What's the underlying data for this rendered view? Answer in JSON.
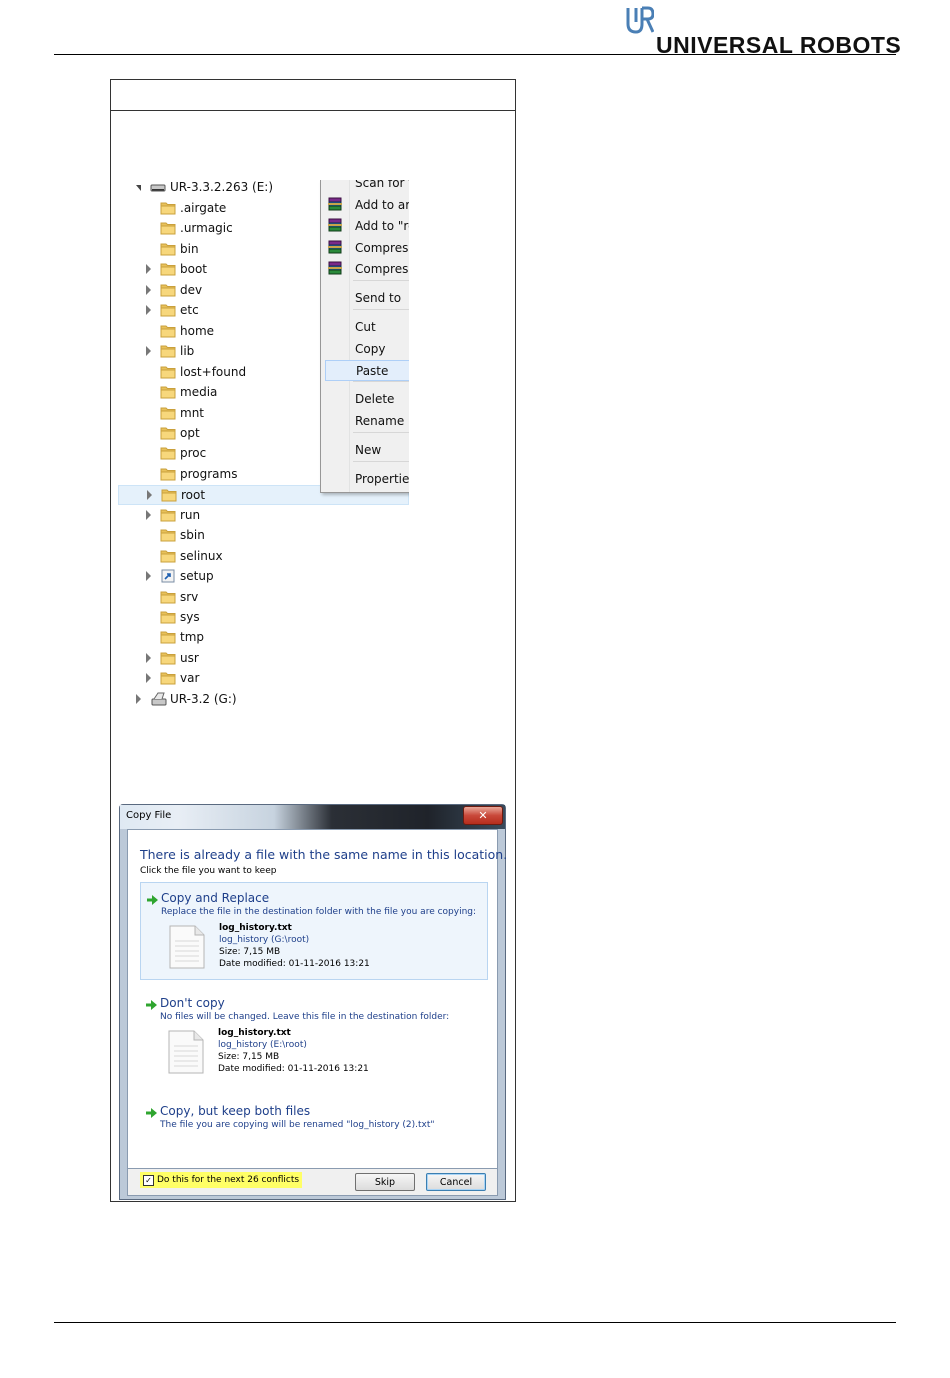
{
  "header": {
    "brand": "UNIVERSAL ROBOTS"
  },
  "explorer": {
    "drive_e": "UR-3.3.2.263 (E:)",
    "folders": [
      {
        "name": ".airgate",
        "expand": false
      },
      {
        "name": ".urmagic",
        "expand": false
      },
      {
        "name": "bin",
        "expand": false
      },
      {
        "name": "boot",
        "expand": true
      },
      {
        "name": "dev",
        "expand": true
      },
      {
        "name": "etc",
        "expand": true
      },
      {
        "name": "home",
        "expand": false
      },
      {
        "name": "lib",
        "expand": true
      },
      {
        "name": "lost+found",
        "expand": false
      },
      {
        "name": "media",
        "expand": false
      },
      {
        "name": "mnt",
        "expand": false
      },
      {
        "name": "opt",
        "expand": false
      },
      {
        "name": "proc",
        "expand": false
      },
      {
        "name": "programs",
        "expand": false
      },
      {
        "name": "root",
        "expand": true,
        "selected": true
      },
      {
        "name": "run",
        "expand": true
      },
      {
        "name": "sbin",
        "expand": false
      },
      {
        "name": "selinux",
        "expand": false
      },
      {
        "name": "setup",
        "expand": true,
        "shortcut": true
      },
      {
        "name": "srv",
        "expand": false
      },
      {
        "name": "sys",
        "expand": false
      },
      {
        "name": "tmp",
        "expand": false
      },
      {
        "name": "usr",
        "expand": true
      },
      {
        "name": "var",
        "expand": true
      }
    ],
    "drive_g": "UR-3.2 (G:)"
  },
  "context_menu": {
    "items": [
      {
        "label": "Scan for vi",
        "icon": ""
      },
      {
        "label": "Add to arc",
        "icon": "winrar-icon"
      },
      {
        "label": "Add to \"ro",
        "icon": "winrar-icon"
      },
      {
        "label": "Compress",
        "icon": "winrar-icon"
      },
      {
        "label": "Compress",
        "icon": "winrar-icon"
      },
      {
        "label": "Send to",
        "icon": ""
      },
      {
        "label": "Cut",
        "icon": ""
      },
      {
        "label": "Copy",
        "icon": ""
      },
      {
        "label": "Paste",
        "icon": "",
        "hover": true
      },
      {
        "label": "Delete",
        "icon": ""
      },
      {
        "label": "Rename",
        "icon": ""
      },
      {
        "label": "New",
        "icon": ""
      },
      {
        "label": "Properties",
        "icon": ""
      }
    ]
  },
  "dialog": {
    "title": "Copy File",
    "close": "✕",
    "heading": "There is already a file with the same name in this location.",
    "subheading": "Click the file you want to keep",
    "options": [
      {
        "title": "Copy and Replace",
        "desc": "Replace the file in the destination folder with the file you are copying:",
        "file_name": "log_history.txt",
        "file_path": "log_history (G:\\root)",
        "file_size": "Size: 7,15 MB",
        "file_date": "Date modified: 01-11-2016 13:21"
      },
      {
        "title": "Don't copy",
        "desc": "No files will be changed. Leave this file in the destination folder:",
        "file_name": "log_history.txt",
        "file_path": "log_history (E:\\root)",
        "file_size": "Size: 7,15 MB",
        "file_date": "Date modified: 01-11-2016 13:21"
      },
      {
        "title": "Copy, but keep both files",
        "desc": "The file you are copying will be renamed \"log_history (2).txt\""
      }
    ],
    "conflicts_label": "Do this for the next 26 conflicts",
    "conflicts_checked": "✓",
    "skip": "Skip",
    "cancel": "Cancel"
  }
}
